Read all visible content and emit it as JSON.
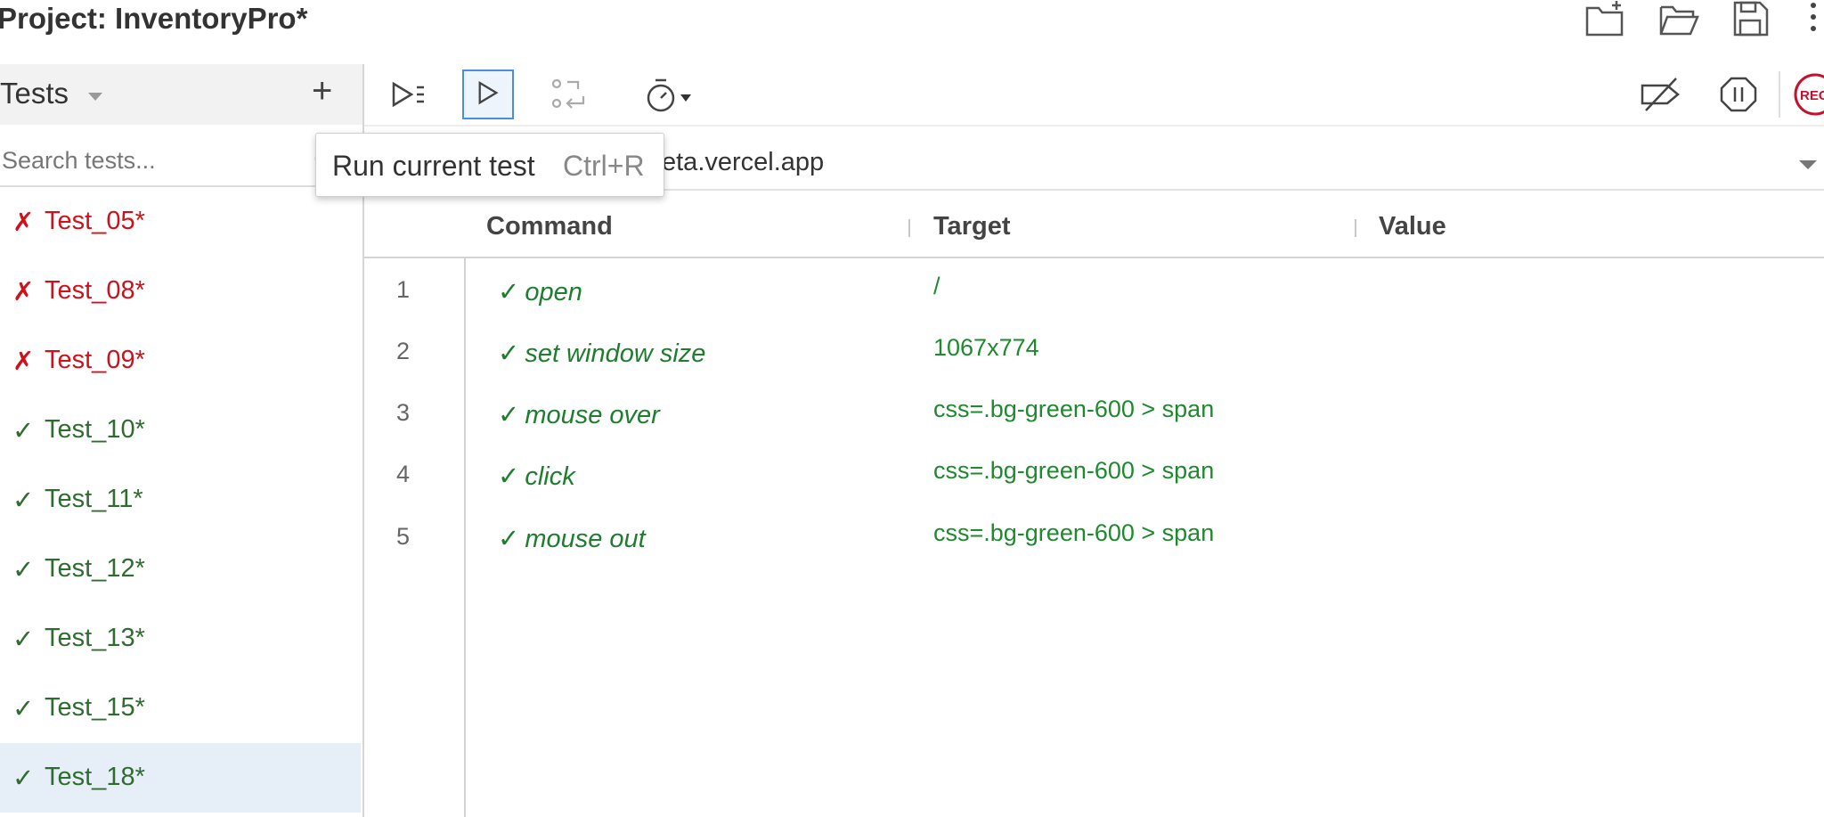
{
  "header": {
    "project_label": "Project:",
    "project_name": "InventoryPro*",
    "icons": [
      "new-project-icon",
      "open-project-icon",
      "save-project-icon",
      "more-menu-icon"
    ]
  },
  "sidebar": {
    "title": "Tests",
    "search_placeholder": "Search tests...",
    "tests": [
      {
        "mark": "✗",
        "name": "Test_05*",
        "status": "fail"
      },
      {
        "mark": "✗",
        "name": "Test_08*",
        "status": "fail"
      },
      {
        "mark": "✗",
        "name": "Test_09*",
        "status": "fail"
      },
      {
        "mark": "✓",
        "name": "Test_10*",
        "status": "pass"
      },
      {
        "mark": "✓",
        "name": "Test_11*",
        "status": "pass"
      },
      {
        "mark": "✓",
        "name": "Test_12*",
        "status": "pass"
      },
      {
        "mark": "✓",
        "name": "Test_13*",
        "status": "pass"
      },
      {
        "mark": "✓",
        "name": "Test_15*",
        "status": "pass"
      },
      {
        "mark": "✓",
        "name": "Test_18*",
        "status": "pass",
        "selected": true
      }
    ]
  },
  "toolbar": {
    "icons": [
      "run-all-tests-icon",
      "run-current-test-icon",
      "step-over-icon",
      "speed-icon",
      "disable-breakpoints-icon",
      "pause-on-exceptions-icon",
      "record-icon"
    ],
    "record_label": "REC"
  },
  "tooltip": {
    "text": "Run current test",
    "shortcut": "Ctrl+R"
  },
  "url_bar": {
    "visible_value": "eta.vercel.app"
  },
  "table": {
    "headers": [
      "Command",
      "Target",
      "Value"
    ],
    "rows": [
      {
        "num": "1",
        "command": "open",
        "target": "/",
        "value": ""
      },
      {
        "num": "2",
        "command": "set window size",
        "target": "1067x774",
        "value": ""
      },
      {
        "num": "3",
        "command": "mouse over",
        "target": "css=.bg-green-600 > span",
        "value": ""
      },
      {
        "num": "4",
        "command": "click",
        "target": "css=.bg-green-600 > span",
        "value": ""
      },
      {
        "num": "5",
        "command": "mouse out",
        "target": "css=.bg-green-600 > span",
        "value": ""
      }
    ],
    "check_mark": "✓"
  },
  "colors": {
    "fail": "#d0101a",
    "pass_test": "#2f6c2f",
    "pass_command": "#1e7e2e",
    "selected_row": "#e6eff7",
    "record_red": "#c8102e",
    "accent_blue": "#4a8ee0"
  }
}
